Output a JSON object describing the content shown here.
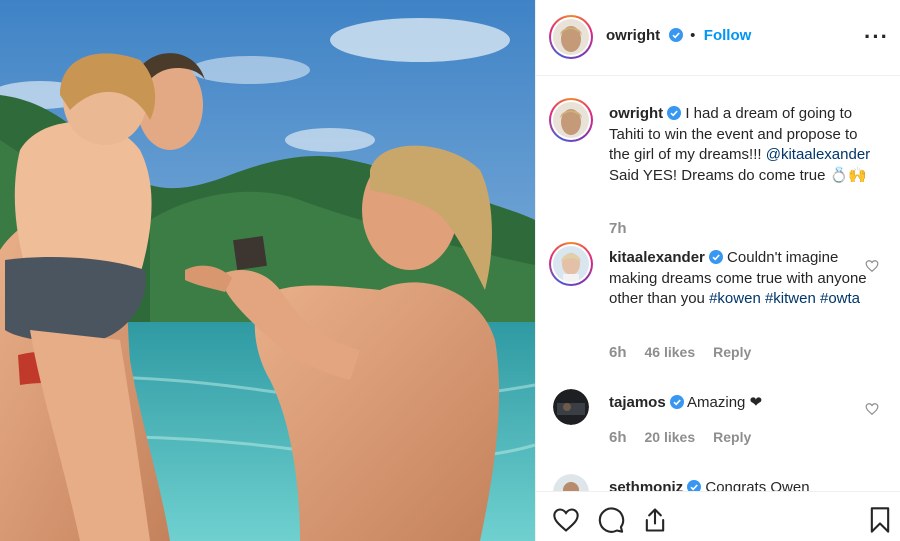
{
  "post": {
    "username": "owright",
    "follow_label": "Follow",
    "dot": "•",
    "more_label": "···"
  },
  "caption": {
    "username": "owright",
    "text_1": " I had a dream of going to Tahiti to win the event and propose to the girl of my dreams!!! ",
    "mention": "@kitaalexander",
    "text_2": " Said YES! Dreams do come true 💍🙌",
    "time": "7h"
  },
  "comments": [
    {
      "username": "kitaalexander",
      "text": " Couldn't imagine making dreams come true with anyone other than you ",
      "tags": "#kowen #kitwen #owta",
      "time": "6h",
      "likes": "46 likes",
      "reply": "Reply"
    },
    {
      "username": "tajamos",
      "text": " Amazing ❤",
      "time": "6h",
      "likes": "20 likes",
      "reply": "Reply"
    },
    {
      "username": "sethmoniz",
      "text": " Congrats Owen"
    }
  ],
  "colors": {
    "link": "#0095f6",
    "mention": "#00376b",
    "verified": "#3897f0",
    "muted": "#8e8e8e"
  },
  "icons": [
    "verified-badge-icon",
    "more-options-icon",
    "heart-icon",
    "comment-icon",
    "share-icon",
    "bookmark-icon"
  ]
}
